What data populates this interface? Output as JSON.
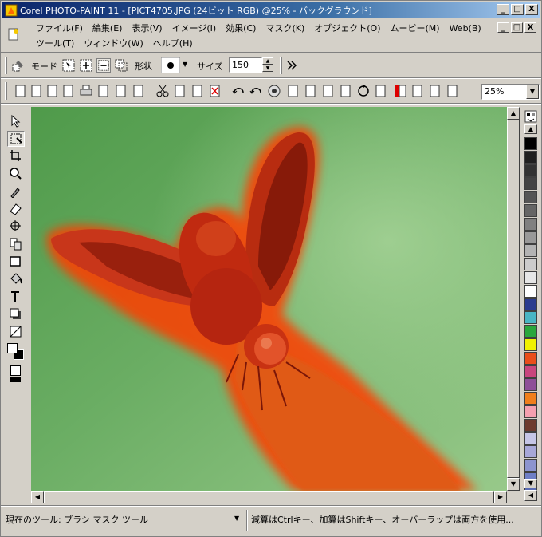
{
  "window": {
    "title": "Corel PHOTO-PAINT 11 - [PICT4705.JPG (24ビット RGB) @25% - バックグラウンド]",
    "min_label": "_",
    "max_label": "□",
    "close_label": "X"
  },
  "menu": {
    "row1": [
      "ファイル(F)",
      "編集(E)",
      "表示(V)",
      "イメージ(I)",
      "効果(C)",
      "マスク(K)",
      "オブジェクト(O)",
      "ムービー(M)",
      "Web(B)"
    ],
    "row2": [
      "ツール(T)",
      "ウィンドウ(W)",
      "ヘルプ(H)"
    ]
  },
  "propbar": {
    "mode_label": "モード",
    "shape_label": "形状",
    "size_label": "サイズ",
    "size_value": "150"
  },
  "stdbar": {
    "zoom_value": "25%"
  },
  "status": {
    "tool_text": "現在のツール: ブラシ マスク ツール",
    "hint_text": "減算はCtrlキー、加算はShiftキー、オーバーラップは両方を使用..."
  },
  "colors": {
    "title_start": "#0a246a",
    "title_end": "#a6caf0",
    "mask_overlay": "#ff3c00",
    "background_green": "#74b06a",
    "chrome": "#d4d0c8"
  },
  "palette": [
    "#000000",
    "#202020",
    "#333333",
    "#444444",
    "#555555",
    "#666666",
    "#808080",
    "#999999",
    "#b3b3b3",
    "#cccccc",
    "#e6e6e6",
    "#ffffff",
    "#2b3c8f",
    "#49b5c4",
    "#2aa63d",
    "#f0f000",
    "#e94e1b",
    "#c8467e",
    "#8e4f98",
    "#f07f1c",
    "#f4a0b0",
    "#6d3b2f",
    "#c5c5e6",
    "#a7a7d8",
    "#8c94cf",
    "#6f7fc6",
    "#5a6cb5"
  ],
  "icons": {
    "app": "photo-paint-icon",
    "tools": [
      "pick-tool-icon",
      "mask-brush-tool-icon",
      "crop-tool-icon",
      "zoom-tool-icon",
      "eyedropper-tool-icon",
      "eraser-tool-icon",
      "effect-tool-icon",
      "clone-tool-icon",
      "rectangle-tool-icon",
      "fill-tool-icon",
      "text-tool-icon",
      "shadow-tool-icon",
      "transparency-tool-icon"
    ]
  }
}
